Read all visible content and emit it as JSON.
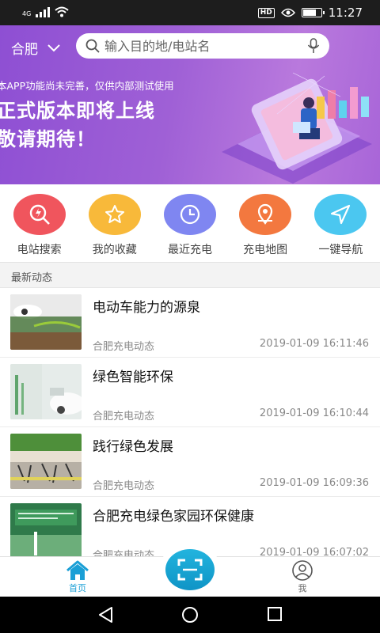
{
  "status_bar": {
    "network_type": "4G",
    "time": "11:27",
    "hd_badge": "HD",
    "battery_level": 0.75,
    "icons": [
      "signal-icon",
      "wifi-icon",
      "hd-icon",
      "eye-icon",
      "battery-icon"
    ]
  },
  "header": {
    "city": "合肥",
    "search_placeholder": "输入目的地/电站名"
  },
  "banner": {
    "notice": "本APP功能尚未完善，仅供内部测试使用",
    "headline_1": "正式版本即将上线",
    "headline_2": "敬请期待！"
  },
  "quick_actions": [
    {
      "label": "电站搜索",
      "icon": "station-search-icon",
      "color": "#f0555d"
    },
    {
      "label": "我的收藏",
      "icon": "star-icon",
      "color": "#f8b93a"
    },
    {
      "label": "最近充电",
      "icon": "clock-icon",
      "color": "#7f86f1"
    },
    {
      "label": "充电地图",
      "icon": "map-pin-icon",
      "color": "#f3783f"
    },
    {
      "label": "一键导航",
      "icon": "navigation-arrow-icon",
      "color": "#4bc7f0"
    }
  ],
  "section": {
    "title": "最新动态"
  },
  "news": [
    {
      "title": "电动车能力的源泉",
      "source": "合肥充电动态",
      "time": "2019-01-09 16:11:46"
    },
    {
      "title": "绿色智能环保",
      "source": "合肥充电动态",
      "time": "2019-01-09 16:10:44"
    },
    {
      "title": "践行绿色发展",
      "source": "合肥充电动态",
      "time": "2019-01-09 16:09:36"
    },
    {
      "title": "合肥充电绿色家园环保健康",
      "source": "合肥充电动态",
      "time": "2019-01-09 16:07:02"
    }
  ],
  "tabbar": {
    "home_label": "首页",
    "me_label": "我",
    "active_color": "#1a9fd6"
  },
  "colors": {
    "banner_purple": "#9f60d6",
    "accent_blue": "#1a9fd6"
  }
}
